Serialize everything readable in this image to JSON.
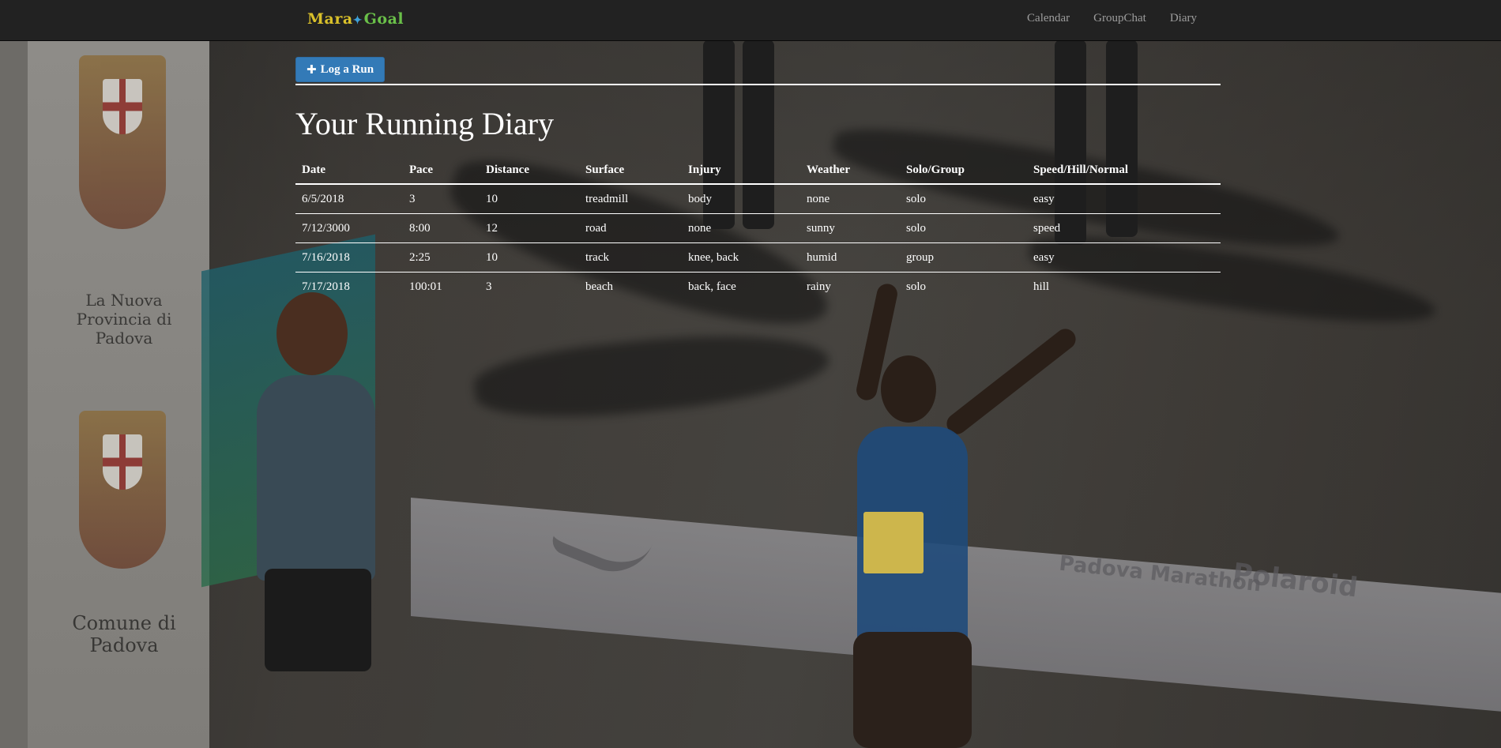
{
  "navbar": {
    "brand": {
      "part1": "Mara",
      "part2": "Goal"
    },
    "links": [
      {
        "label": "Calendar"
      },
      {
        "label": "GroupChat"
      },
      {
        "label": "Diary"
      }
    ]
  },
  "main": {
    "log_button_label": "Log a Run",
    "title": "Your Running Diary",
    "table": {
      "columns": [
        "Date",
        "Pace",
        "Distance",
        "Surface",
        "Injury",
        "Weather",
        "Solo/Group",
        "Speed/Hill/Normal"
      ],
      "rows": [
        [
          "6/5/2018",
          "3",
          "10",
          "treadmill",
          "body",
          "none",
          "solo",
          "easy"
        ],
        [
          "7/12/3000",
          "8:00",
          "12",
          "road",
          "none",
          "sunny",
          "solo",
          "speed"
        ],
        [
          "7/16/2018",
          "2:25",
          "10",
          "track",
          "knee, back",
          "humid",
          "group",
          "easy"
        ],
        [
          "7/17/2018",
          "100:01",
          "3",
          "beach",
          "back, face",
          "rainy",
          "solo",
          "hill"
        ]
      ]
    }
  },
  "background": {
    "signage": {
      "panel_top": "La Nuova Provincia di Padova",
      "panel_bottom": "Comune di Padova",
      "banner_brands": [
        "Padova Marathon",
        "Polaroid"
      ]
    }
  },
  "colors": {
    "navbar_bg": "#222222",
    "nav_link": "#9d9d9d",
    "button_primary": "#337ab7",
    "text": "#ffffff"
  },
  "icons": {
    "log_button": "plus-icon"
  }
}
